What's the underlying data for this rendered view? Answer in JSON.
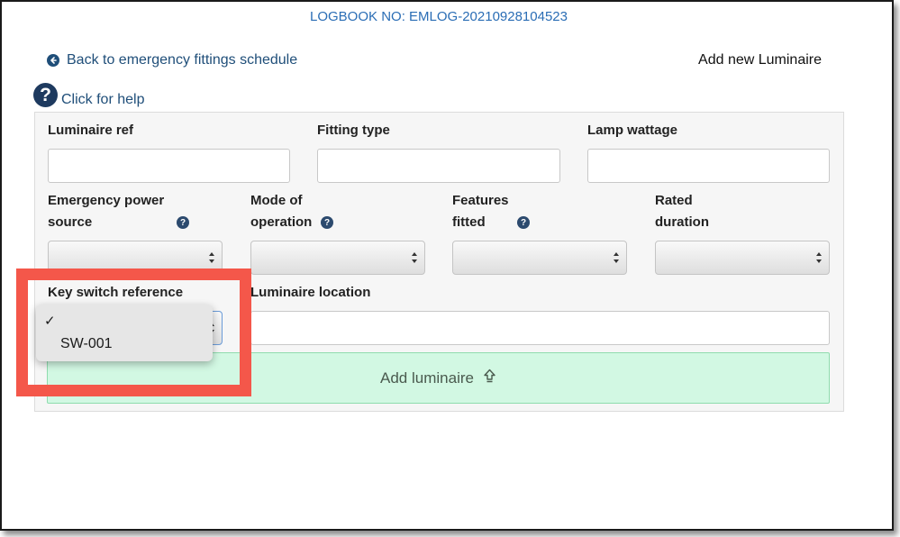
{
  "logbook": "LOGBOOK NO: EMLOG-20210928104523",
  "back_link": "Back to emergency fittings schedule",
  "page_heading": "Add new Luminaire",
  "help_label": "Click for help",
  "form": {
    "luminaire_ref": {
      "label": "Luminaire ref",
      "value": ""
    },
    "fitting_type": {
      "label": "Fitting type",
      "value": ""
    },
    "lamp_wattage": {
      "label": "Lamp wattage",
      "value": ""
    },
    "emergency_power_source": {
      "label_line1": "Emergency power",
      "label_line2": "source",
      "value": ""
    },
    "mode_of_operation": {
      "label_line1": "Mode of",
      "label_line2": "operation",
      "value": ""
    },
    "features_fitted": {
      "label_line1": "Features",
      "label_line2": "fitted",
      "value": ""
    },
    "rated_duration": {
      "label_line1": "Rated",
      "label_line2": "duration",
      "value": ""
    },
    "key_switch_reference": {
      "label": "Key switch reference",
      "value": ""
    },
    "luminaire_location": {
      "label": "Luminaire location",
      "value": ""
    },
    "add_button": "Add luminaire"
  },
  "dropdown": {
    "options": [
      {
        "label": "",
        "checked": true,
        "check_glyph": "✓"
      },
      {
        "label": "SW-001",
        "checked": false
      }
    ]
  },
  "colors": {
    "link": "#1f4e79",
    "logbook": "#2a6db5",
    "highlight": "#f4574a",
    "add_button_bg": "#d2f8e3"
  },
  "icons": {
    "back": "circle-arrow-left-icon",
    "help": "question-circle-icon",
    "add": "upload-arrow-icon"
  }
}
